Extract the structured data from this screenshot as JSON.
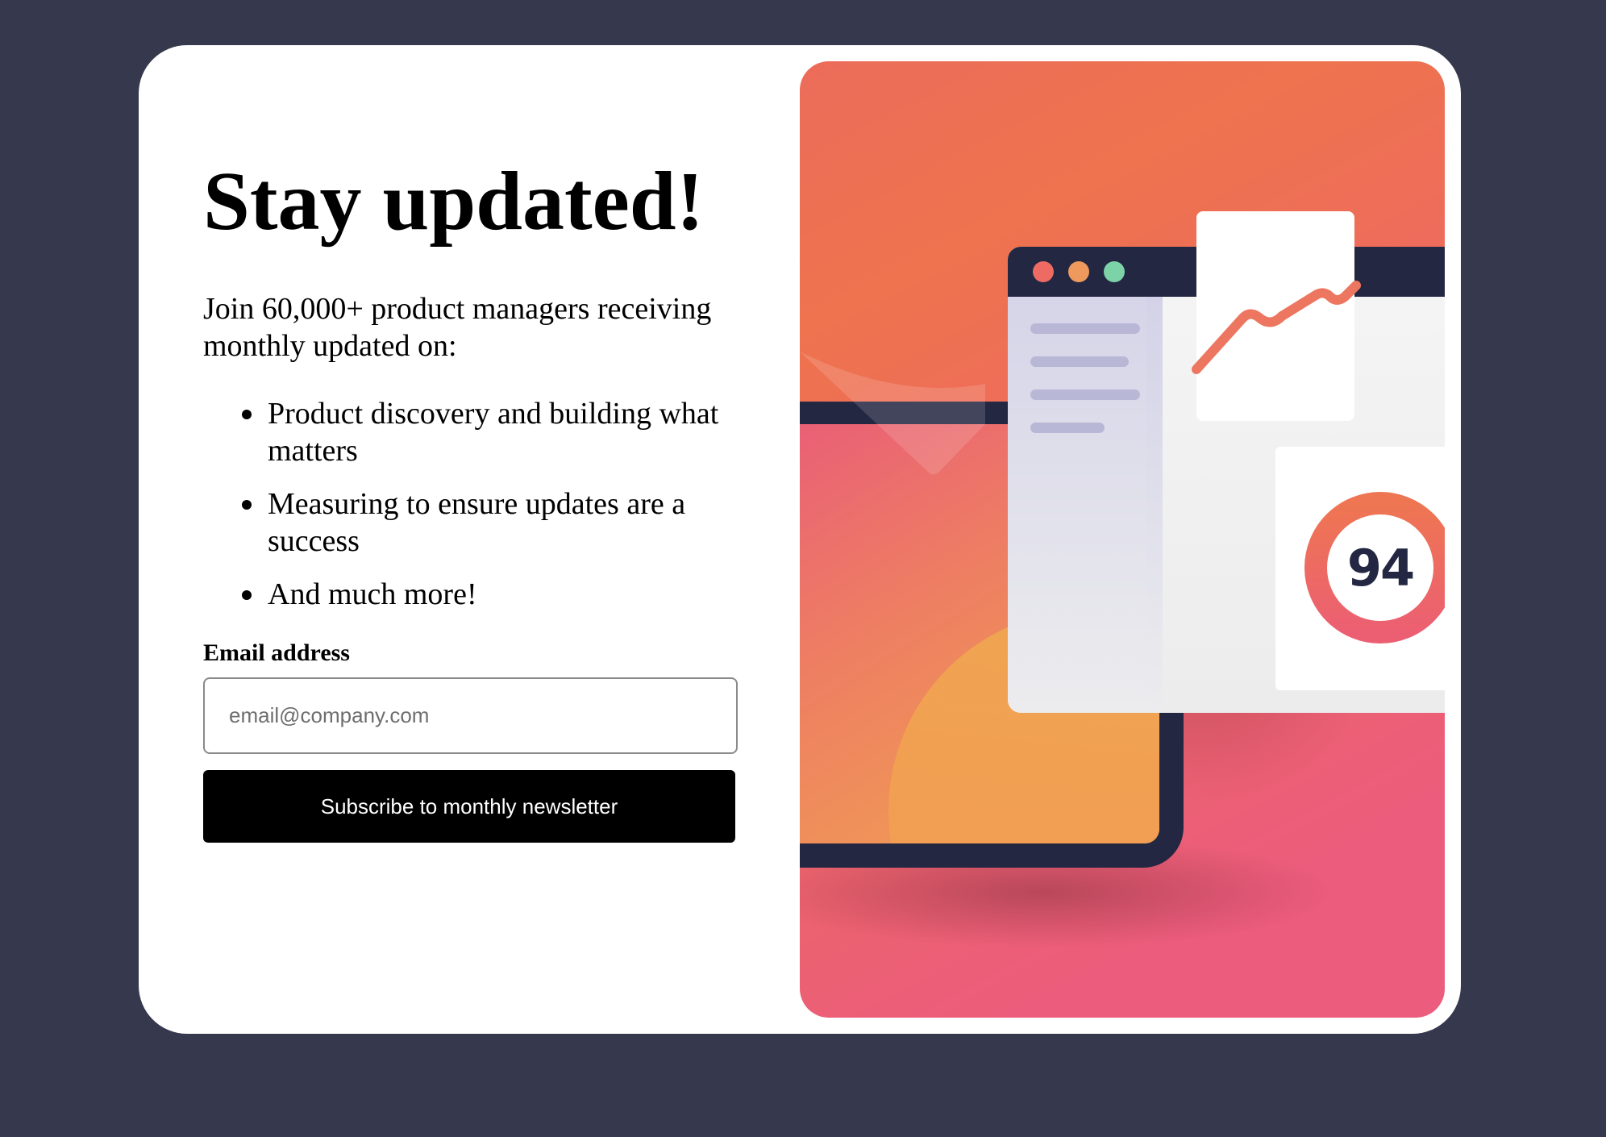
{
  "signup": {
    "title": "Stay updated!",
    "intro": "Join 60,000+ product managers receiving monthly updated on:",
    "features": [
      "Product discovery and building what matters",
      "Measuring to ensure updates are a success",
      "And much more!"
    ],
    "email_label": "Email address",
    "email_placeholder": "email@company.com",
    "subscribe_label": "Subscribe to monthly newsletter"
  },
  "illustration": {
    "score": "94",
    "window_dots": [
      "red-dot",
      "orange-dot",
      "green-dot"
    ]
  },
  "colors": {
    "page_background": "#36384d",
    "card_background": "#ffffff",
    "button_background": "#000000",
    "illustration_gradient_top": "#ed7350",
    "illustration_gradient_bottom": "#ec5c7b",
    "device_frame": "#242742",
    "score_ring": "#ed6a5a"
  }
}
